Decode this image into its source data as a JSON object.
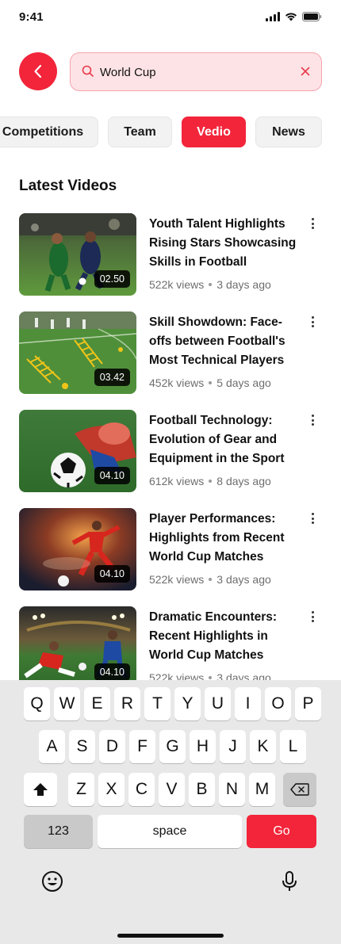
{
  "status": {
    "time": "9:41"
  },
  "search": {
    "value": "World Cup"
  },
  "tabs": [
    {
      "label": "Competitions"
    },
    {
      "label": "Team"
    },
    {
      "label": "Vedio"
    },
    {
      "label": "News"
    }
  ],
  "section": {
    "title": "Latest Videos"
  },
  "videos": [
    {
      "title": "Youth Talent Highlights Rising Stars Showcasing Skills in Football",
      "views": "522k views",
      "age": "3 days ago",
      "duration": "02.50"
    },
    {
      "title": "Skill Showdown: Face-offs between Football's Most Technical Players",
      "views": "452k views",
      "age": "5 days ago",
      "duration": "03.42"
    },
    {
      "title": "Football Technology: Evolution of Gear and Equipment in the Sport",
      "views": "612k views",
      "age": "8 days ago",
      "duration": "04.10"
    },
    {
      "title": "Player Performances: Highlights from Recent World Cup Matches",
      "views": "522k views",
      "age": "3 days ago",
      "duration": "04.10"
    },
    {
      "title": "Dramatic Encounters: Recent Highlights in World Cup Matches",
      "views": "522k views",
      "age": "3 days ago",
      "duration": "04.10"
    }
  ],
  "keyboard": {
    "row1": [
      "Q",
      "W",
      "E",
      "R",
      "T",
      "Y",
      "U",
      "I",
      "O",
      "P"
    ],
    "row2": [
      "A",
      "S",
      "D",
      "F",
      "G",
      "H",
      "J",
      "K",
      "L"
    ],
    "row3": [
      "Z",
      "X",
      "C",
      "V",
      "B",
      "N",
      "M"
    ],
    "numbers": "123",
    "space": "space",
    "go": "Go"
  },
  "colors": {
    "accent": "#f2253a",
    "search_bg": "#fde3e5",
    "tab_bg": "#f2f2f2",
    "keyboard_bg": "#e8e8e8"
  }
}
